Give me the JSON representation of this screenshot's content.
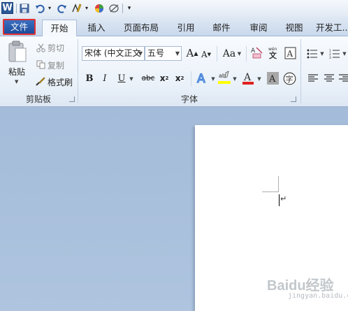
{
  "quick_access": {
    "app_icon": "word-app-icon",
    "app_letter": "W",
    "items": [
      "save-icon",
      "undo-icon",
      "redo-icon",
      "format-painter-icon",
      "color-wheel-icon",
      "eraser-icon",
      "customize-icon"
    ]
  },
  "tabs": [
    "文件",
    "开始",
    "插入",
    "页面布局",
    "引用",
    "邮件",
    "审阅",
    "视图",
    "开发工..."
  ],
  "clipboard": {
    "paste": "粘贴",
    "cut": "剪切",
    "copy": "复制",
    "format_painter": "格式刷",
    "group_label": "剪贴板"
  },
  "font": {
    "font_name": "宋体 (中文正文",
    "font_size": "五号",
    "group_label": "字体",
    "font_color_accent": "#e02020",
    "highlight_accent": "#ffff00"
  },
  "watermark": {
    "text": "Baidu经验",
    "url": "jingyan.baidu.com"
  }
}
